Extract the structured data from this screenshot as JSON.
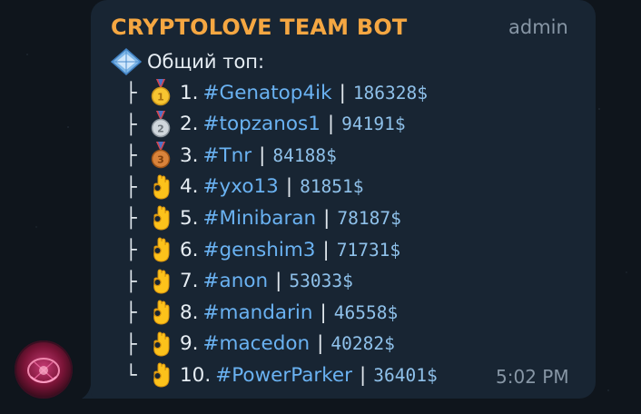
{
  "message": {
    "sender": "CRYPTOLOVE TEAM BOT",
    "role": "admin",
    "header_text": "Общий топ:",
    "time": "5:02 PM"
  },
  "leaderboard": [
    {
      "branch": "├",
      "icon": "gold-medal",
      "rank": "1.",
      "tag": "#Genatop4ik",
      "sep": "|",
      "amount": "186328$"
    },
    {
      "branch": "├",
      "icon": "silver-medal",
      "rank": "2.",
      "tag": "#topzanos1",
      "sep": "|",
      "amount": "94191$"
    },
    {
      "branch": "├",
      "icon": "bronze-medal",
      "rank": "3.",
      "tag": "#Tnr",
      "sep": "|",
      "amount": "84188$"
    },
    {
      "branch": "├",
      "icon": "ok-hand",
      "rank": "4.",
      "tag": "#yxo13",
      "sep": "|",
      "amount": "81851$"
    },
    {
      "branch": "├",
      "icon": "ok-hand",
      "rank": "5.",
      "tag": "#Minibaran",
      "sep": "|",
      "amount": "78187$"
    },
    {
      "branch": "├",
      "icon": "ok-hand",
      "rank": "6.",
      "tag": "#genshim3",
      "sep": "|",
      "amount": "71731$"
    },
    {
      "branch": "├",
      "icon": "ok-hand",
      "rank": "7.",
      "tag": "#anon",
      "sep": "|",
      "amount": "53033$"
    },
    {
      "branch": "├",
      "icon": "ok-hand",
      "rank": "8.",
      "tag": "#mandarin",
      "sep": "|",
      "amount": "46558$"
    },
    {
      "branch": "├",
      "icon": "ok-hand",
      "rank": "9.",
      "tag": "#macedon",
      "sep": "|",
      "amount": "40282$"
    },
    {
      "branch": "└",
      "icon": "ok-hand",
      "rank": "10.",
      "tag": "#PowerParker",
      "sep": "|",
      "amount": "36401$"
    }
  ],
  "colors": {
    "background": "#0f151c",
    "bubble": "#182533",
    "sender": "#f5a742",
    "hashtag": "#6ab2f2",
    "amount": "#8fc1ea",
    "meta": "#8796a5"
  }
}
